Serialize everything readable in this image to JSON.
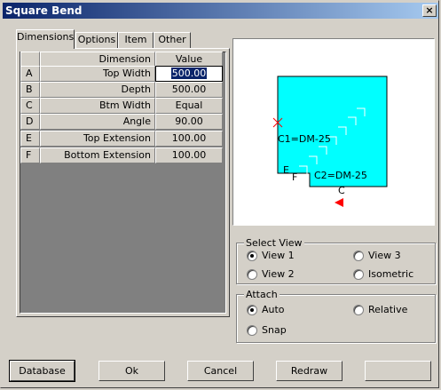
{
  "window": {
    "title": "Square Bend",
    "close_label": "×"
  },
  "tabs": [
    "Dimensions",
    "Options",
    "Item",
    "Other"
  ],
  "grid": {
    "headers": {
      "dimension": "Dimension",
      "value": "Value"
    },
    "rows": [
      {
        "letter": "A",
        "dimension": "Top Width",
        "value": "500.00",
        "editing": true
      },
      {
        "letter": "B",
        "dimension": "Depth",
        "value": "500.00"
      },
      {
        "letter": "C",
        "dimension": "Btm Width",
        "value": "Equal"
      },
      {
        "letter": "D",
        "dimension": "Angle",
        "value": "90.00"
      },
      {
        "letter": "E",
        "dimension": "Top Extension",
        "value": "100.00"
      },
      {
        "letter": "F",
        "dimension": "Bottom Extension",
        "value": "100.00"
      }
    ]
  },
  "preview": {
    "c1_label": "C1=DM-25",
    "c2_label": "C2=DM-25",
    "e_label": "E",
    "f_label": "F",
    "c_label": "C",
    "fill_color": "#00ffff",
    "marker_color": "#ff0000"
  },
  "select_view": {
    "label": "Select View",
    "options": [
      "View 1",
      "View 3",
      "View 2",
      "Isometric"
    ],
    "selected": "View 1"
  },
  "attach": {
    "label": "Attach",
    "options": [
      "Auto",
      "Relative",
      "Snap"
    ],
    "selected": "Auto"
  },
  "buttons": {
    "database": "Database",
    "ok": "Ok",
    "cancel": "Cancel",
    "redraw": "Redraw",
    "blank": ""
  }
}
